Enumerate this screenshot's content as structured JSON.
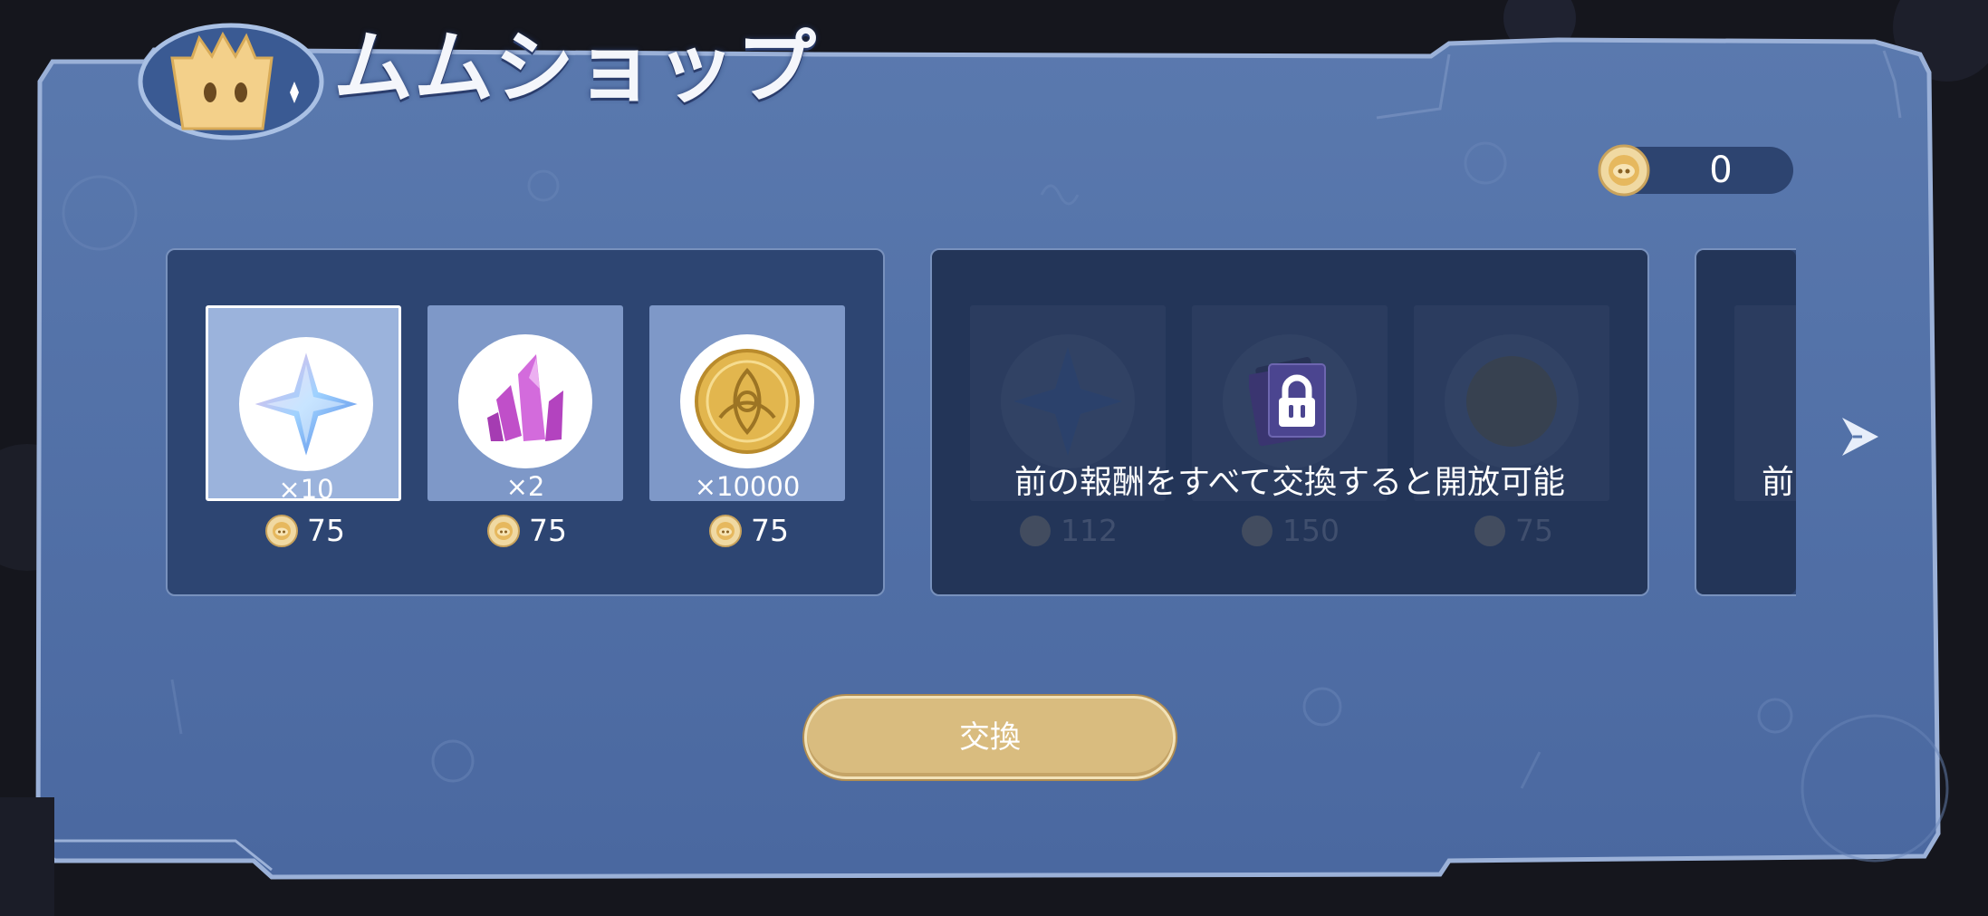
{
  "shop": {
    "title": "ムムショップ",
    "currency": {
      "icon": "mumu-token-icon",
      "amount": "0"
    }
  },
  "groups": [
    {
      "locked": false,
      "items": [
        {
          "icon": "intertwined-fate-star-icon",
          "quantity": "×10",
          "cost": "75",
          "selected": true
        },
        {
          "icon": "purple-crystal-icon",
          "quantity": "×2",
          "cost": "75",
          "selected": false
        },
        {
          "icon": "gold-mora-coin-icon",
          "quantity": "×10000",
          "cost": "75",
          "selected": false
        }
      ]
    },
    {
      "locked": true,
      "lock_message": "前の報酬をすべて交換すると開放可能",
      "items": [
        {
          "icon": "intertwined-fate-star-icon",
          "cost": "112"
        },
        {
          "icon": "purple-book-icon",
          "cost": "150"
        },
        {
          "icon": "gold-mora-coin-icon",
          "cost": "75"
        }
      ]
    },
    {
      "locked": true,
      "lock_message_partial": "前"
    }
  ],
  "actions": {
    "exchange_label": "交換"
  },
  "colors": {
    "panel": "#4d6da3",
    "panel_border": "#9bb1d8",
    "group_bg": "#2d4572",
    "item_card": "#7e98c8",
    "button": "#d9bc7f",
    "gold": "#e2b64e"
  }
}
